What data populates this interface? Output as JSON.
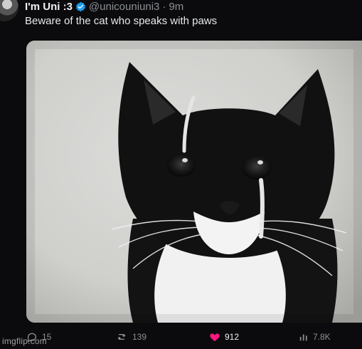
{
  "tweet": {
    "author_name": "I'm Uni :3",
    "handle": "@unicouniuni3",
    "separator": "·",
    "time": "9m",
    "text": "Beware of the cat who speaks with paws"
  },
  "image": {
    "subject": "black-and-white tuxedo cat with a tear-like streak under one eye"
  },
  "actions": {
    "reply_count": "15",
    "retweet_count": "139",
    "like_count": "912",
    "views_count": "7.8K"
  },
  "colors": {
    "background": "#0b0b0d",
    "like_color": "#f91880",
    "verified_color": "#1d9bf0",
    "muted_text": "#8b8f94"
  },
  "watermark": "imgflip.com"
}
